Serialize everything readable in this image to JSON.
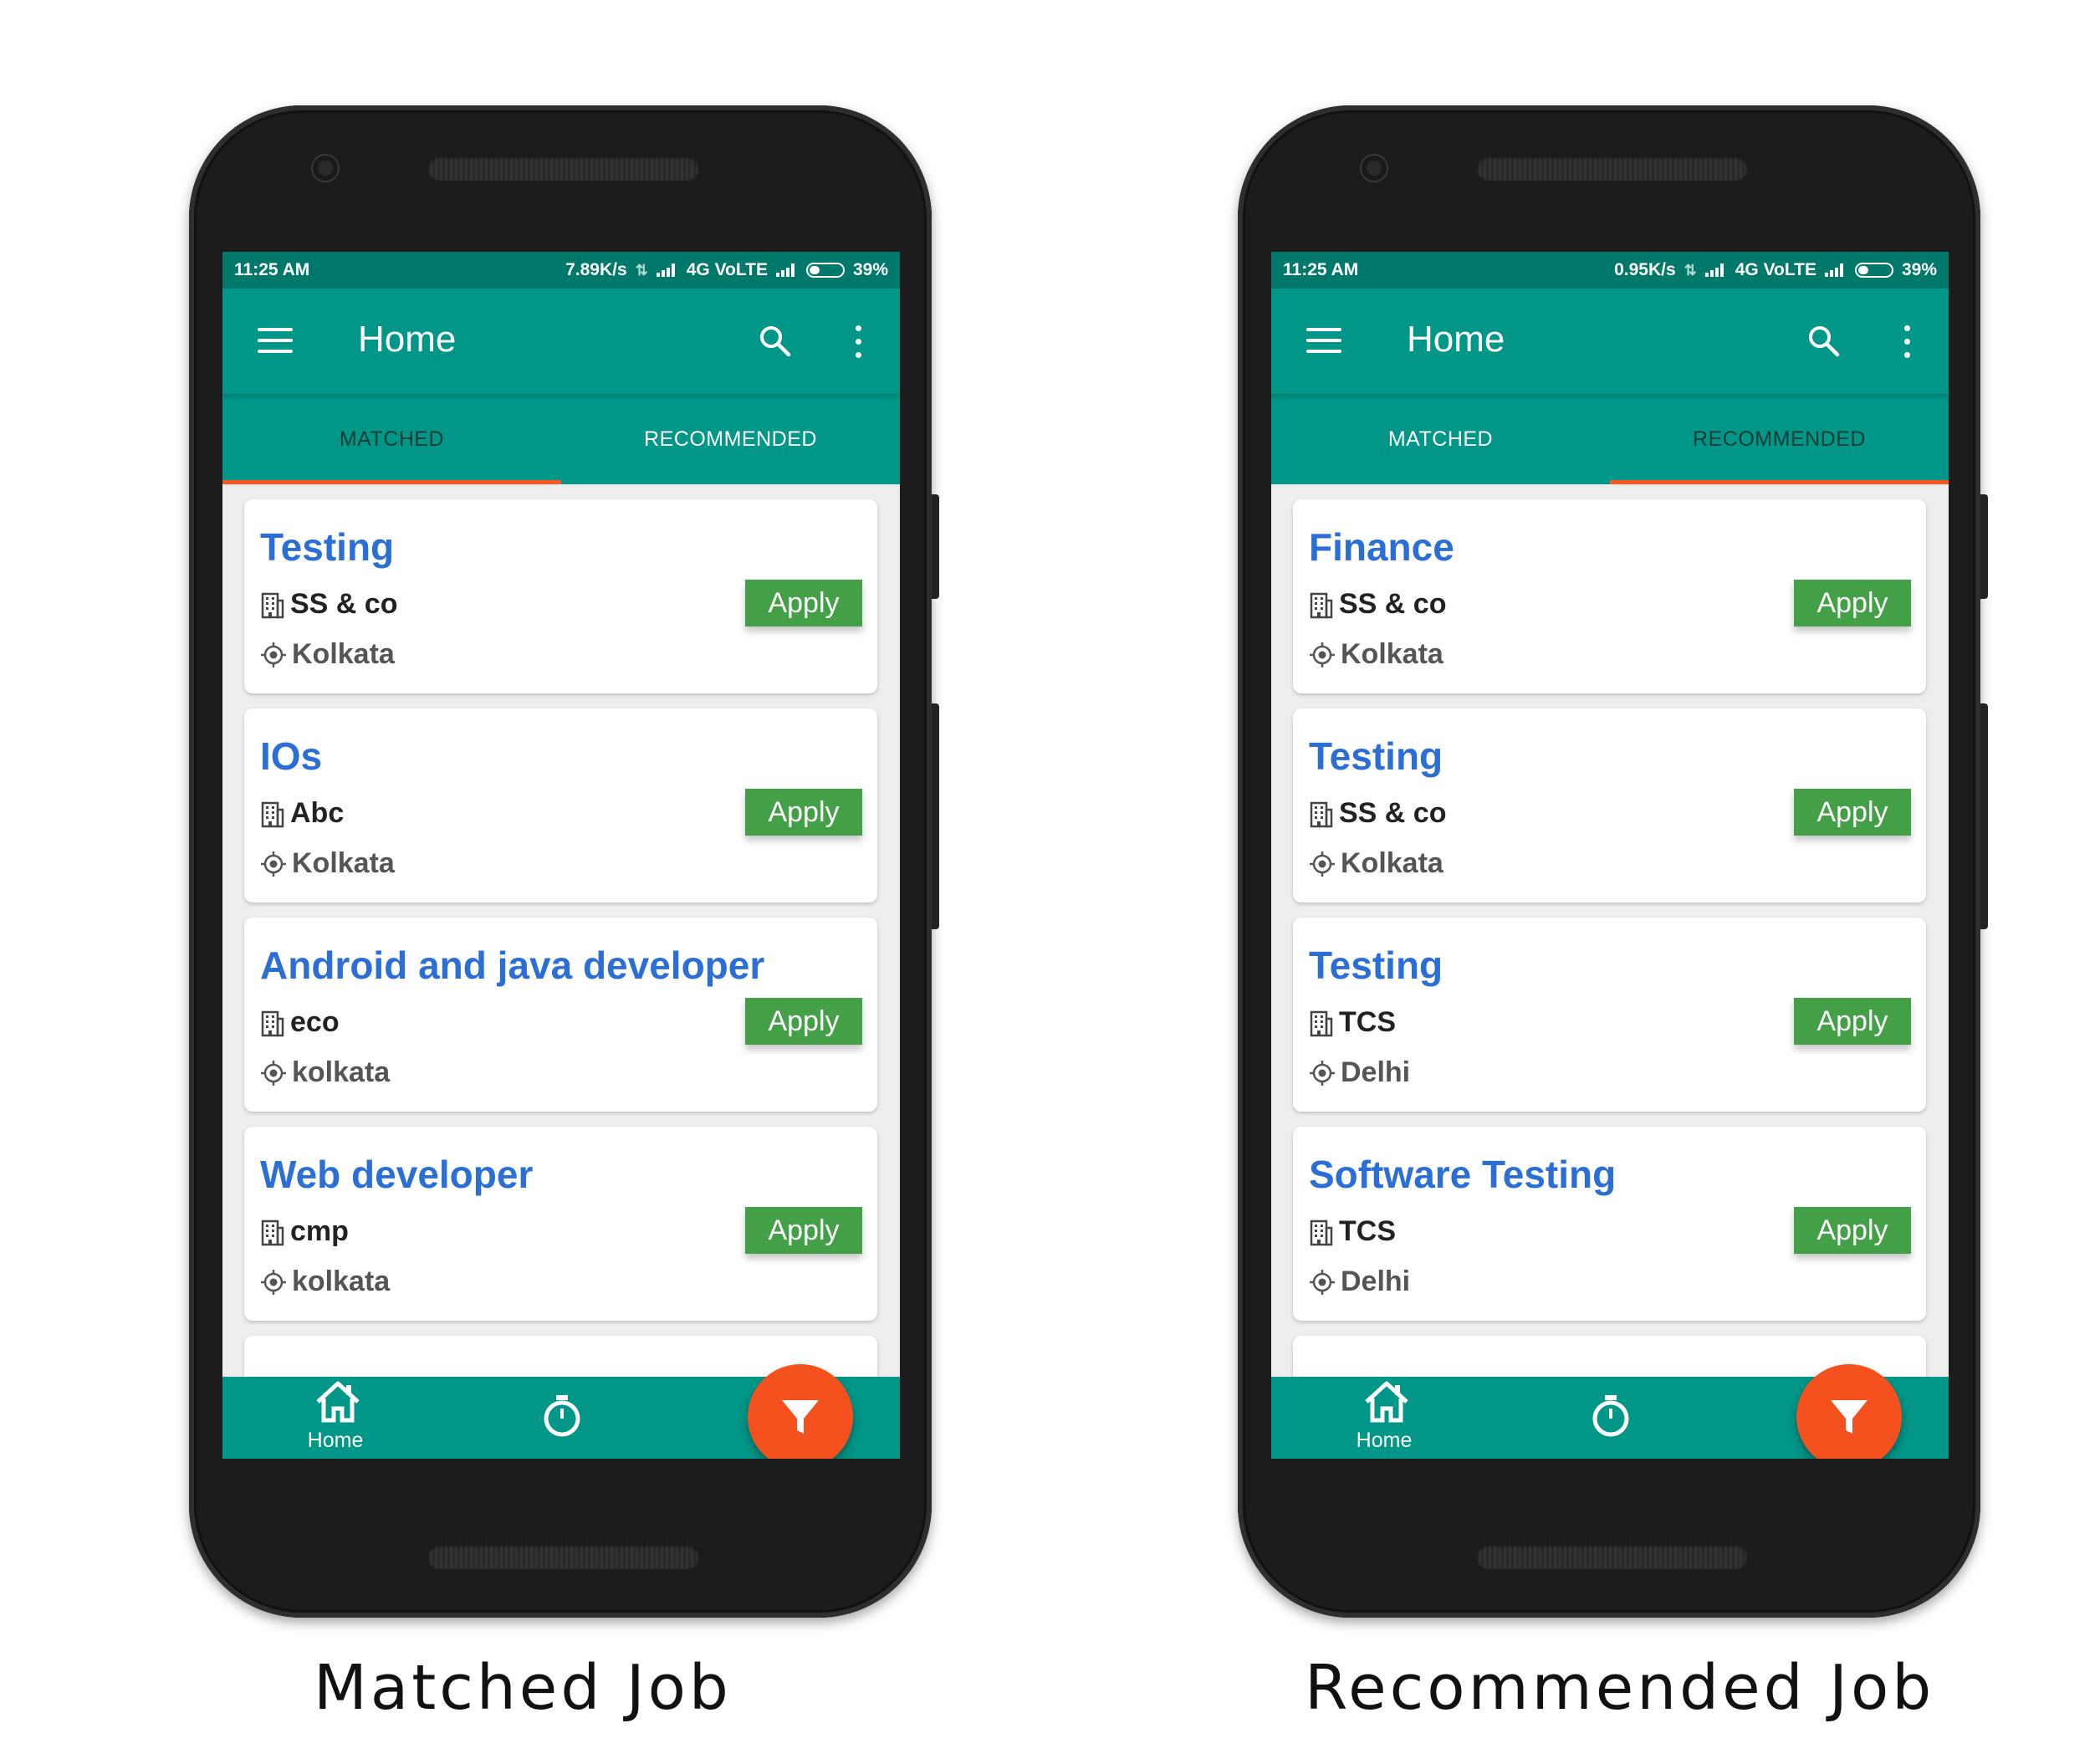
{
  "phones": [
    {
      "caption": "Matched Job",
      "status": {
        "time": "11:25 AM",
        "speed": "7.89K/s",
        "network": "4G VoLTE",
        "battery": "39%"
      },
      "appbar": {
        "title": "Home"
      },
      "tabs": [
        {
          "label": "MATCHED",
          "active": true
        },
        {
          "label": "RECOMMENDED",
          "active": false
        }
      ],
      "jobs": [
        {
          "title": "Testing",
          "company": "SS & co",
          "location": "Kolkata",
          "apply_label": "Apply"
        },
        {
          "title": "IOs",
          "company": "Abc",
          "location": "Kolkata",
          "apply_label": "Apply"
        },
        {
          "title": "Android and java developer",
          "company": "eco",
          "location": "kolkata",
          "apply_label": "Apply"
        },
        {
          "title": "Web developer",
          "company": "cmp",
          "location": "kolkata",
          "apply_label": "Apply"
        }
      ],
      "bottom_nav": [
        {
          "label": "Home",
          "icon": "home-icon"
        },
        {
          "label": "",
          "icon": "stopwatch-icon"
        },
        {
          "label": "",
          "icon": "bell-icon"
        }
      ]
    },
    {
      "caption": "Recommended Job",
      "status": {
        "time": "11:25 AM",
        "speed": "0.95K/s",
        "network": "4G VoLTE",
        "battery": "39%"
      },
      "appbar": {
        "title": "Home"
      },
      "tabs": [
        {
          "label": "MATCHED",
          "active": false
        },
        {
          "label": "RECOMMENDED",
          "active": true
        }
      ],
      "jobs": [
        {
          "title": "Finance",
          "company": "SS & co",
          "location": "Kolkata",
          "apply_label": "Apply"
        },
        {
          "title": "Testing",
          "company": "SS & co",
          "location": "Kolkata",
          "apply_label": "Apply"
        },
        {
          "title": "Testing",
          "company": "TCS",
          "location": "Delhi",
          "apply_label": "Apply"
        },
        {
          "title": "Software Testing",
          "company": "TCS",
          "location": "Delhi",
          "apply_label": "Apply"
        }
      ],
      "bottom_nav": [
        {
          "label": "Home",
          "icon": "home-icon"
        },
        {
          "label": "",
          "icon": "stopwatch-icon"
        },
        {
          "label": "",
          "icon": "bell-icon"
        }
      ]
    }
  ],
  "colors": {
    "primary": "#009688",
    "primary_dark": "#00796b",
    "accent": "#ff5722",
    "title_blue": "#2b6fd6",
    "apply_green": "#43a047"
  }
}
